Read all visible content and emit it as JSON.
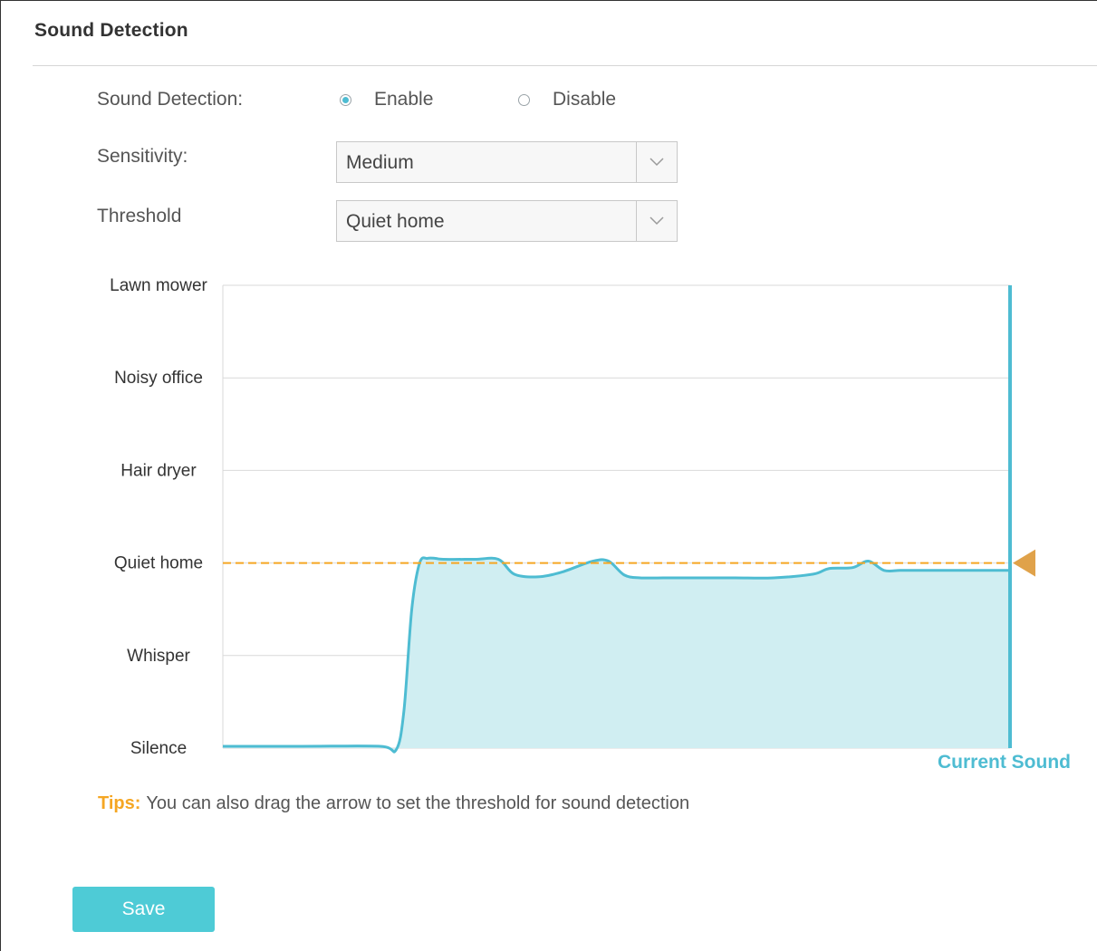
{
  "section": {
    "title": "Sound Detection"
  },
  "sound_detection": {
    "label": "Sound Detection:",
    "options": [
      {
        "label": "Enable",
        "checked": true
      },
      {
        "label": "Disable",
        "checked": false
      }
    ]
  },
  "sensitivity": {
    "label": "Sensitivity:",
    "value": "Medium"
  },
  "threshold": {
    "label": "Threshold",
    "value": "Quiet home"
  },
  "chart_data": {
    "type": "area",
    "title": "",
    "xlabel": "",
    "ylabel": "",
    "y_levels": [
      "Silence",
      "Whisper",
      "Quiet home",
      "Hair dryer",
      "Noisy office",
      "Lawn mower"
    ],
    "ylim": [
      0,
      5
    ],
    "x_range": [
      0,
      100
    ],
    "threshold": 2,
    "current_sound_label": "Current Sound",
    "grid": true,
    "colors": {
      "line": "#4ebcd2",
      "fill": "#d0eef2",
      "threshold": "#f5a623",
      "arrow": "#e0a24a",
      "grid": "#d9d9d9"
    },
    "series": [
      {
        "x": [
          0,
          10,
          20,
          22,
          23,
          24,
          25,
          26,
          27,
          28,
          32,
          35,
          37,
          40,
          43,
          47,
          49,
          51,
          53,
          56,
          60,
          65,
          70,
          75,
          77,
          80,
          82,
          84,
          86,
          88,
          92,
          96,
          100
        ],
        "values": [
          0.02,
          0.02,
          0.02,
          -0.02,
          0.4,
          1.5,
          2.0,
          2.05,
          2.05,
          2.04,
          2.04,
          2.04,
          1.88,
          1.85,
          1.9,
          2.02,
          2.02,
          1.87,
          1.84,
          1.84,
          1.84,
          1.84,
          1.84,
          1.88,
          1.94,
          1.95,
          2.02,
          1.92,
          1.92,
          1.92,
          1.92,
          1.92,
          1.92
        ]
      }
    ]
  },
  "tips": {
    "label": "Tips:",
    "text": "You can also drag the arrow to set the threshold for sound detection"
  },
  "save": {
    "label": "Save"
  }
}
